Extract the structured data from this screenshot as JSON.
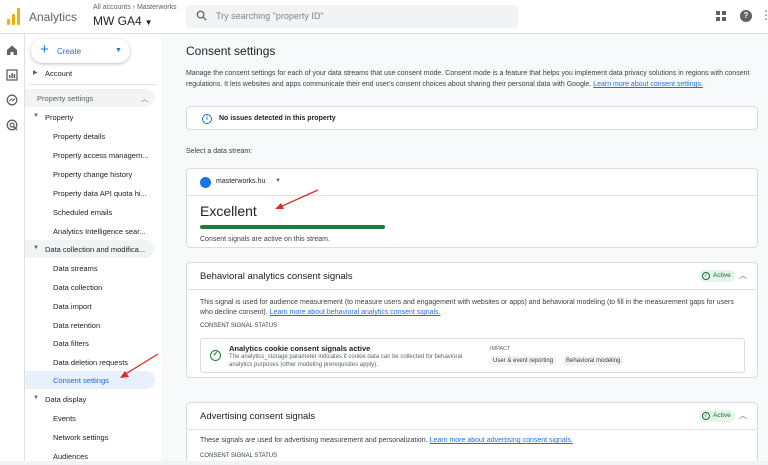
{
  "topbar": {
    "app_name": "Analytics",
    "breadcrumb": "All accounts › Masterworks",
    "property_name": "MW GA4",
    "search_placeholder": "Try searching \"property ID\"",
    "help_glyph": "?"
  },
  "sidenav": {
    "create_label": "Create",
    "account_label": "Account",
    "property_settings_label": "Property settings",
    "property_group": "Property",
    "property_items": [
      "Property details",
      "Property access managem...",
      "Property change history",
      "Property data API quota hi...",
      "Scheduled emails",
      "Analytics Intelligence sear..."
    ],
    "data_collection_group": "Data collection and modifica...",
    "data_collection_items": [
      "Data streams",
      "Data collection",
      "Data import",
      "Data retention",
      "Data filters",
      "Data deletion requests",
      "Consent settings"
    ],
    "data_display_group": "Data display",
    "data_display_items": [
      "Events",
      "Network settings",
      "Audiences"
    ]
  },
  "main": {
    "title": "Consent settings",
    "description": "Manage the consent settings for each of your data streams that use consent mode. Consent mode is a feature that helps you implement data privacy solutions in regions with consent regulations. It lets websites and apps communicate their end user's consent choices about sharing their personal data with Google.",
    "learn_more": "Learn more about consent settings.",
    "info_text": "No issues detected in this property",
    "select_stream_label": "Select a data stream:",
    "stream_name": "masterworks.hu",
    "status_heading": "Excellent",
    "status_caption": "Consent signals are active on this stream.",
    "behavioral": {
      "title": "Behavioral analytics consent signals",
      "badge": "Active",
      "description": "This signal is used for audience measurement (to measure users and engagement with websites or apps) and behavioral modeling (to fill in the measurement gaps for users who decline consent).",
      "link": "Learn more about behavioral analytics consent signals.",
      "status_label": "CONSENT SIGNAL STATUS",
      "signal_title": "Analytics cookie consent signals active",
      "signal_desc": "The analytics_storage parameter indicates if cookie data can be collected for behavioral analytics purposes (other modeling prerequisites apply).",
      "impact_label": "IMPACT",
      "impact_chips": [
        "User & event reporting",
        "Behavioral modeling"
      ]
    },
    "advertising": {
      "title": "Advertising consent signals",
      "badge": "Active",
      "description": "These signals are used for advertising measurement and personalization.",
      "link": "Learn more about advertising consent signals.",
      "status_label": "CONSENT SIGNAL STATUS"
    }
  },
  "colors": {
    "accent": "#1a73e8",
    "success": "#188038",
    "annotation_arrow": "#d93025",
    "logo": "#f9ab00"
  },
  "icons": [
    "analytics-logo",
    "search-icon",
    "apps-grid-icon",
    "help-icon",
    "more-vert-icon",
    "home-icon",
    "reports-icon",
    "explore-icon",
    "advertising-icon",
    "info-icon",
    "globe-icon",
    "check-circle-icon"
  ]
}
